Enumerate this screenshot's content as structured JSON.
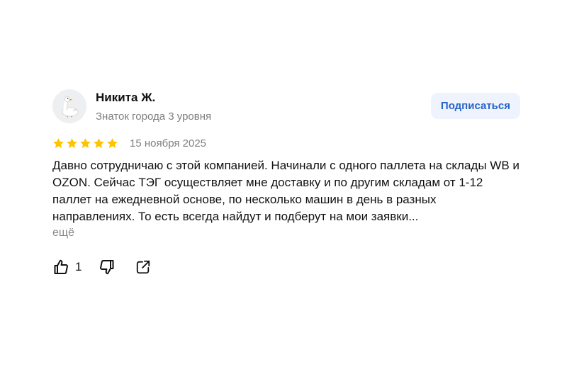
{
  "review": {
    "author_name": "Никита Ж.",
    "author_level": "Знаток города 3 уровня",
    "subscribe_label": "Подписаться",
    "rating": 5,
    "rating_max": 5,
    "date": "15 ноября 2025",
    "text": "Давно сотрудничаю с этой компанией. Начинали с одного паллета на склады WB и OZON. Сейчас ТЭГ осуществляет мне доставку и по другим складам от 1-12 паллет на ежедневной основе, по несколько машин в день в разных направлениях. То есть всегда найдут и подберут на мои заявки...",
    "more_label": "ещё",
    "likes_count": "1"
  },
  "icons": {
    "avatar": "goose-avatar-icon",
    "star": "star-icon",
    "like": "thumbs-up-icon",
    "dislike": "thumbs-down-icon",
    "share": "share-icon"
  },
  "colors": {
    "star": "#fcc500",
    "subscribe_bg": "#eef3fd",
    "subscribe_text": "#2664c7",
    "muted_text": "#7f7f7f"
  }
}
